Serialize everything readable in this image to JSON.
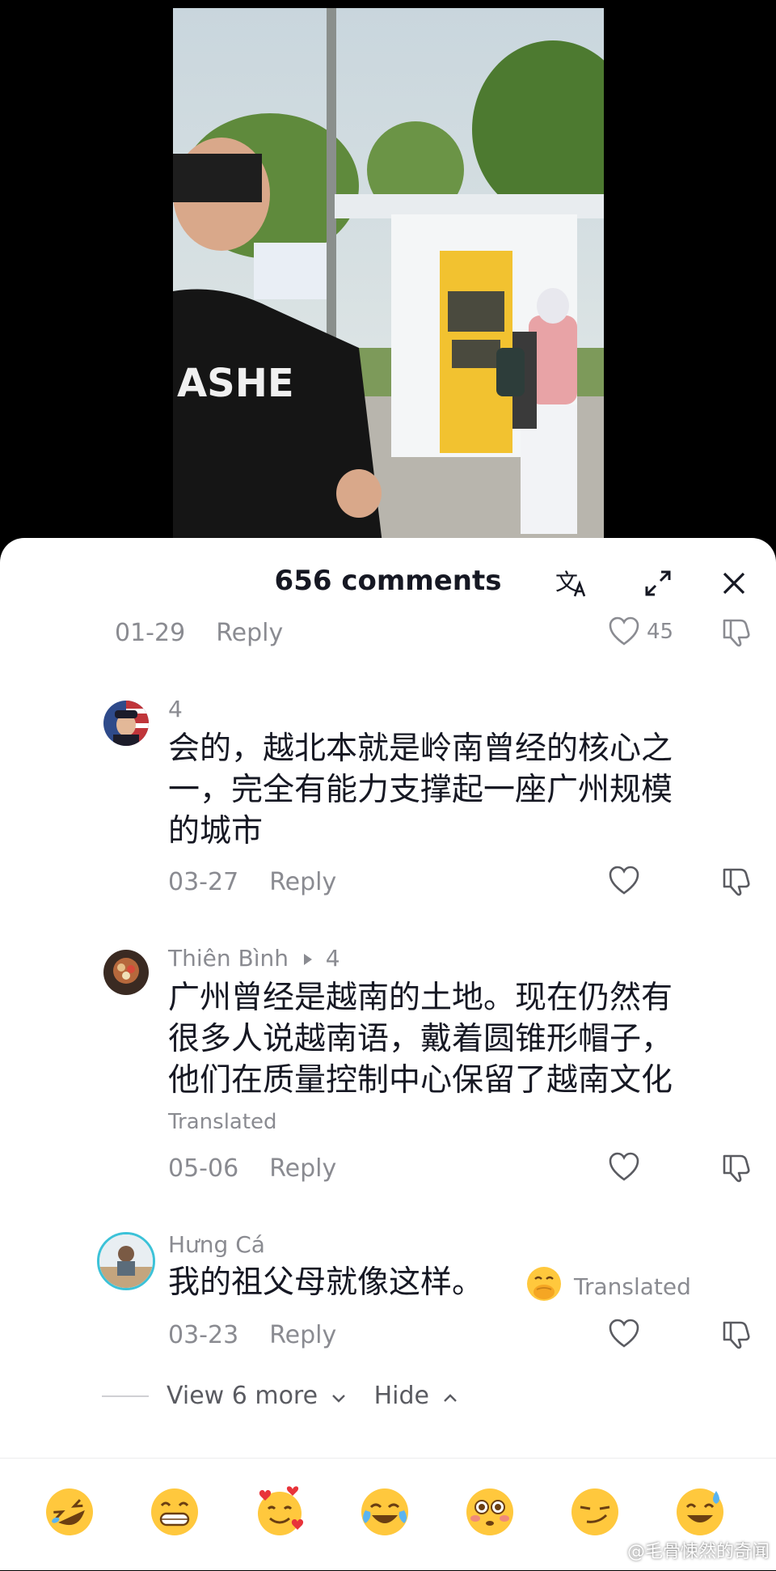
{
  "sheet": {
    "title": "656 comments"
  },
  "top_row": {
    "date": "01-29",
    "reply_label": "Reply",
    "like_count": "45"
  },
  "comments": [
    {
      "username": "4",
      "text_lines": [
        "会的，越北本就是岭南曾经的核心之",
        "一，完全有能力支撑起一座广州规模",
        "的城市"
      ],
      "date": "03-27",
      "reply_label": "Reply"
    },
    {
      "username": "Thiên Bình",
      "reply_to": "4",
      "text_lines": [
        "广州曾经是越南的土地。现在仍然有",
        "很多人说越南语，戴着圆锥形帽子，",
        "他们在质量控制中心保留了越南文化"
      ],
      "translated_label": "Translated",
      "date": "05-06",
      "reply_label": "Reply"
    },
    {
      "username": "Hưng Cá",
      "text": "我的祖父母就像这样。",
      "translated_label": "Translated",
      "date": "03-23",
      "reply_label": "Reply"
    }
  ],
  "expander": {
    "view_more": "View 6 more",
    "hide": "Hide"
  },
  "emojis": [
    "rolling-laughing",
    "grinning",
    "smiling-hearts",
    "tears-of-joy",
    "flushed",
    "smirk",
    "sweat-smile"
  ],
  "watermark": "@毛骨悚然的奇闻",
  "colors": {
    "text": "#161823",
    "muted": "#8a8b91",
    "sheet_bg": "#ffffff"
  }
}
